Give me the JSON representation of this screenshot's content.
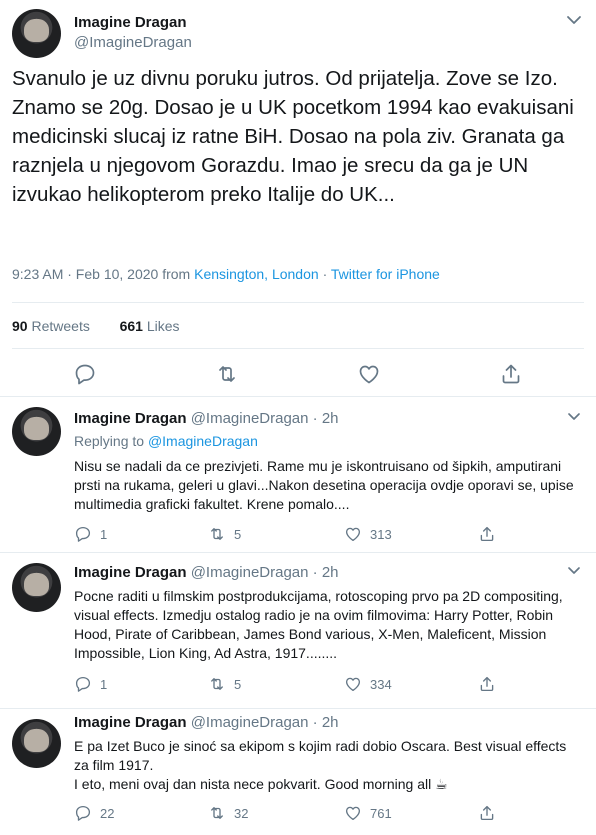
{
  "main_tweet": {
    "author_name": "Imagine Dragan",
    "author_handle": "@ImagineDragan",
    "text": "Svanulo je uz divnu poruku jutros. Od prijatelja. Zove se Izo. Znamo se 20g. Dosao je u UK pocetkom 1994 kao evakuisani medicinski slucaj iz ratne BiH. Dosao na pola ziv. Granata ga raznjela u njegovom Gorazdu. Imao je srecu da ga je UN izvukao helikopterom preko Italije do UK...",
    "time": "9:23 AM · Feb 10, 2020 from",
    "location": "Kensington, London",
    "separator": "·",
    "source": "Twitter for iPhone",
    "retweets_count": "90",
    "retweets_label": "Retweets",
    "likes_count": "661",
    "likes_label": "Likes"
  },
  "replies": [
    {
      "author_name": "Imagine Dragan",
      "author_handle": "@ImagineDragan · 2h",
      "replying_label": "Replying to",
      "replying_to": "@ImagineDragan",
      "text": "Nisu se nadali da ce prezivjeti. Rame mu je iskontruisano od šipkih, amputirani prsti na rukama, geleri u glavi...Nakon desetina operacija ovdje oporavi se, upise multimedia graficki fakultet. Krene pomalo....",
      "reply_count": "1",
      "retweet_count": "5",
      "like_count": "313"
    },
    {
      "author_name": "Imagine Dragan",
      "author_handle": "@ImagineDragan · 2h",
      "text": "Pocne raditi u filmskim postprodukcijama, rotoscoping prvo pa 2D compositing, visual effects. Izmedju ostalog radio je na ovim filmovima: Harry Potter,  Robin Hood, Pirate of Caribbean, James Bond various, X-Men, Maleficent, Mission Impossible, Lion King, Ad Astra, 1917........",
      "reply_count": "1",
      "retweet_count": "5",
      "like_count": "334"
    },
    {
      "author_name": "Imagine Dragan",
      "author_handle": "@ImagineDragan · 2h",
      "text_line1": "E pa Izet Buco je sinoć sa ekipom s kojim radi dobio Oscara. Best visual effects za film 1917.",
      "text_line2": "I eto, meni ovaj dan nista nece pokvarit. Good morning all ☕",
      "reply_count": "22",
      "retweet_count": "32",
      "like_count": "761"
    }
  ],
  "icons": {
    "reply": "reply-icon",
    "retweet": "retweet-icon",
    "like": "heart-icon",
    "share": "share-icon",
    "more": "chevron-down-icon"
  },
  "colors": {
    "link": "#1b95e0",
    "secondary_text": "#657786",
    "primary_text": "#14171a",
    "divider": "#e6ecf0"
  }
}
